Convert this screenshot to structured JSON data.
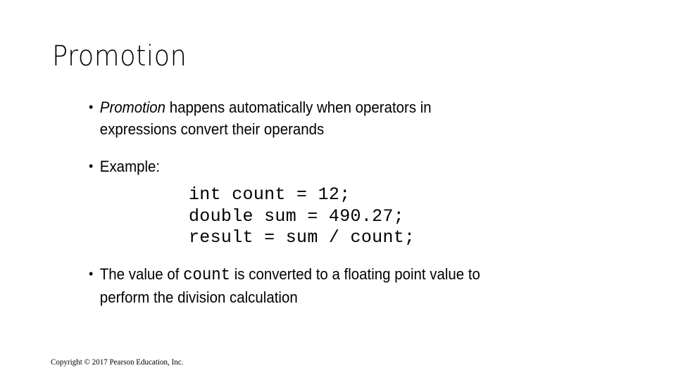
{
  "slide": {
    "title": "Promotion",
    "bullets": [
      {
        "marker": "•",
        "emphasis": "Promotion",
        "text": " happens automatically when operators in expressions convert their operands"
      },
      {
        "marker": "•",
        "text": "Example:"
      },
      {
        "marker": "•",
        "before": "The value of ",
        "code": "count",
        "after": " is converted to a floating point value to perform the division calculation"
      }
    ],
    "code_lines": [
      "int count = 12;",
      "double sum = 490.27;",
      "result = sum / count;"
    ],
    "footer": "Copyright © 2017 Pearson Education, Inc."
  }
}
